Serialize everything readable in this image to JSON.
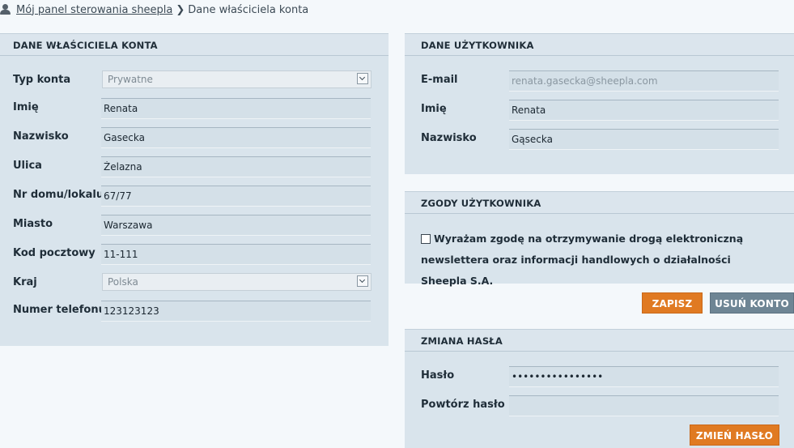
{
  "breadcrumb": {
    "home_label": "Mój panel sterowania sheepla",
    "separator": "❯",
    "current_label": "Dane właściciela konta"
  },
  "owner": {
    "title": "DANE WŁAŚCICIELA KONTA",
    "fields": [
      {
        "label": "Typ konta",
        "value": "Prywatne",
        "type": "select"
      },
      {
        "label": "Imię",
        "value": "Renata"
      },
      {
        "label": "Nazwisko",
        "value": "Gasecka"
      },
      {
        "label": "Ulica",
        "value": "Żelazna"
      },
      {
        "label": "Nr domu/lokalu",
        "value": "67/77"
      },
      {
        "label": "Miasto",
        "value": "Warszawa"
      },
      {
        "label": "Kod pocztowy",
        "value": "11-111"
      },
      {
        "label": "Kraj",
        "value": "Polska",
        "type": "select"
      },
      {
        "label": "Numer telefonu",
        "value": "123123123"
      }
    ]
  },
  "user": {
    "title": "DANE UŻYTKOWNIKA",
    "fields": [
      {
        "label": "E-mail",
        "value": "renata.gasecka@sheepla.com"
      },
      {
        "label": "Imię",
        "value": "Renata"
      },
      {
        "label": "Nazwisko",
        "value": "Gąsecka"
      }
    ]
  },
  "consents": {
    "title": "ZGODY UŻYTKOWNIKA",
    "newsletter_text": "Wyrażam zgodę na otrzymywanie drogą elektroniczną newslettera oraz informacji handlowych o działalności Sheepla S.A.",
    "checked": false
  },
  "actions": {
    "save_label": "ZAPISZ",
    "delete_label": "USUŃ KONTO"
  },
  "password": {
    "title": "ZMIANA HASŁA",
    "password_label": "Hasło",
    "password_value": "passwordpassword",
    "repeat_label": "Powtórz hasło",
    "repeat_value": "",
    "change_label": "ZMIEŃ HASŁO"
  },
  "colors": {
    "accent_orange": "#e07a22",
    "button_grey": "#6e8594",
    "panel_bg": "#d9e4ec"
  }
}
